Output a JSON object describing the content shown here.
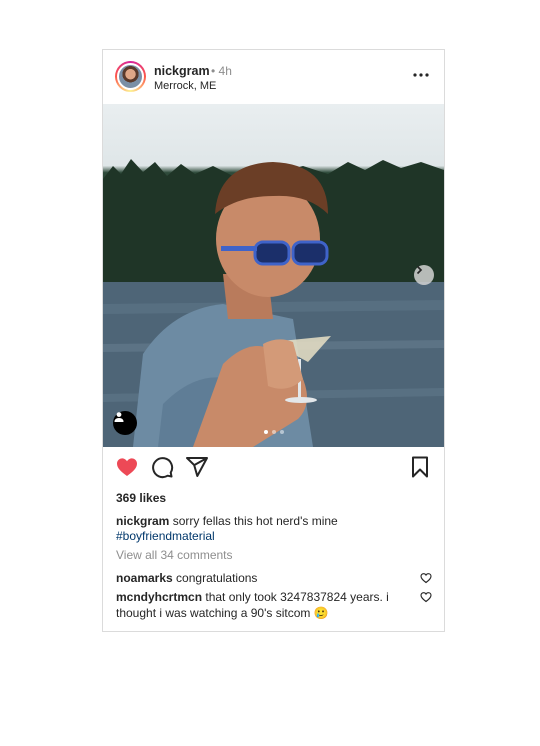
{
  "post": {
    "username": "nickgram",
    "time": "• 4h",
    "location": "Merrock, ME",
    "likes": "369 likes",
    "caption_user": "nickgram",
    "caption_text": "sorry fellas this hot nerd's mine",
    "hashtag": "#boyfriendmaterial",
    "view_all": "View all 34 comments",
    "comments": [
      {
        "user": "noamarks",
        "text": "congratulations"
      },
      {
        "user": "mcndyhcrtmcn",
        "text": "that only took 3247837824 years. i thought i was watching a 90's sitcom 🥲"
      }
    ],
    "liked": true,
    "accent_color": "#ed4956"
  }
}
